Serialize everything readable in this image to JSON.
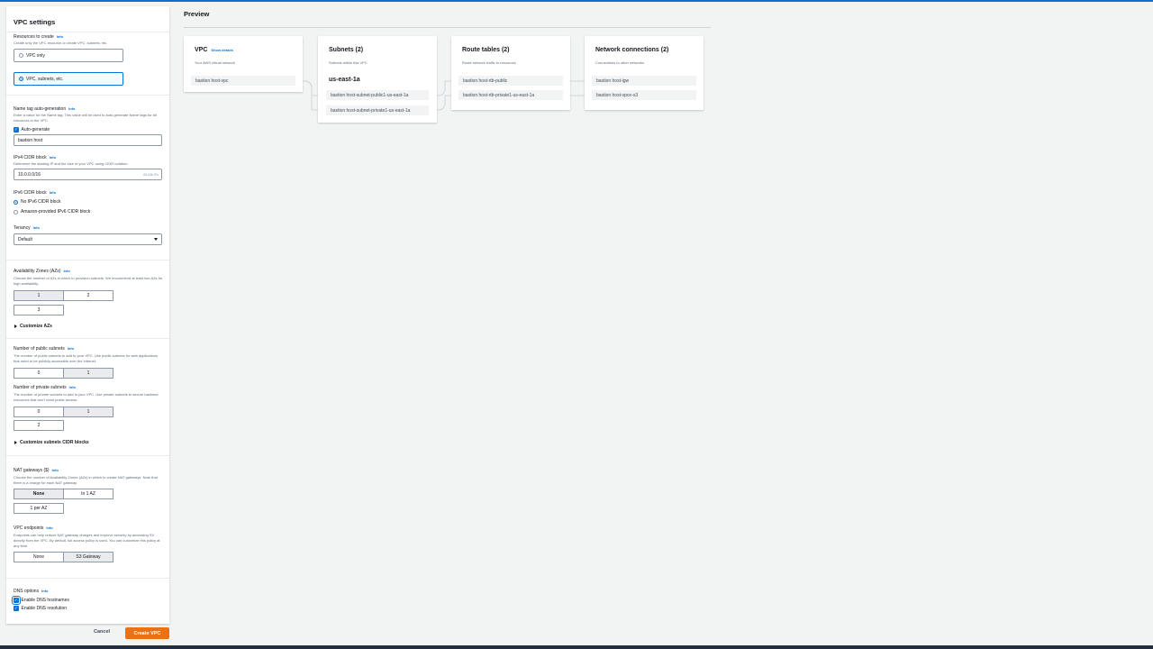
{
  "panel": {
    "title": "VPC settings",
    "info": "Info",
    "resources": {
      "label": "Resources to create",
      "desc": "Create only the VPC resource or create VPC, subnets, etc.",
      "options": [
        "VPC only",
        "VPC, subnets, etc."
      ],
      "selected": "VPC, subnets, etc."
    },
    "name_tag": {
      "label": "Name tag auto-generation",
      "desc": "Enter a value for the Name tag. This value will be used to auto-generate Name tags for all resources in the VPC.",
      "auto_label": "Auto-generate",
      "auto_checked": true,
      "value": "bastion host"
    },
    "ipv4": {
      "label": "IPv4 CIDR block",
      "desc": "Determine the starting IP and the size of your VPC using CIDR notation.",
      "value": "10.0.0.0/16",
      "hint": "65,536 IPs"
    },
    "ipv6": {
      "label": "IPv6 CIDR block",
      "options": [
        "No IPv6 CIDR block",
        "Amazon-provided IPv6 CIDR block"
      ],
      "selected": "No IPv6 CIDR block"
    },
    "tenancy": {
      "label": "Tenancy",
      "value": "Default"
    },
    "azs": {
      "label": "Availability Zones (AZs)",
      "desc": "Choose the number of AZs in which to provision subnets. We recommend at least two AZs for high availability.",
      "options": [
        "1",
        "2",
        "3"
      ],
      "selected": "1",
      "customize": "Customize AZs"
    },
    "public_subnets": {
      "label": "Number of public subnets",
      "desc": "The number of public subnets to add to your VPC. Use public subnets for web applications that need to be publicly accessible over the internet.",
      "options": [
        "0",
        "1"
      ],
      "selected": "1"
    },
    "private_subnets": {
      "label": "Number of private subnets",
      "desc": "The number of private subnets to add to your VPC. Use private subnets to secure backend resources that don't need public access.",
      "options": [
        "0",
        "1",
        "2"
      ],
      "selected": "1",
      "customize": "Customize subnets CIDR blocks"
    },
    "nat": {
      "label": "NAT gateways ($)",
      "desc": "Choose the number of Availability Zones (AZs) in which to create NAT gateways. Note that there is a charge for each NAT gateway",
      "options": [
        "None",
        "In 1 AZ",
        "1 per AZ"
      ],
      "selected": "None"
    },
    "endpoints": {
      "label": "VPC endpoints",
      "desc": "Endpoints can help reduce NAT gateway charges and improve security by accessing S3 directly from the VPC. By default, full access policy is used. You can customize this policy at any time.",
      "options": [
        "None",
        "S3 Gateway"
      ],
      "selected": "S3 Gateway"
    },
    "dns": {
      "label": "DNS options",
      "hostnames": "Enable DNS hostnames",
      "resolution": "Enable DNS resolution"
    },
    "cancel": "Cancel",
    "create": "Create VPC"
  },
  "preview": {
    "title": "Preview",
    "vpc": {
      "title": "VPC",
      "link": "Show details",
      "sub": "Your AWS virtual network",
      "items": [
        "bastion host-vpc"
      ]
    },
    "subnets": {
      "title": "Subnets (2)",
      "sub": "Subnets within this VPC",
      "az": "us-east-1a",
      "items": [
        "bastion host-subnet-public1-us-east-1a",
        "bastion host-subnet-private1-us-east-1a"
      ]
    },
    "route_tables": {
      "title": "Route tables (2)",
      "sub": "Route network traffic to resources",
      "items": [
        "bastion host-rtb-public",
        "bastion host-rtb-private1-us-east-1a"
      ]
    },
    "network": {
      "title": "Network connections (2)",
      "sub": "Connections to other networks",
      "items": [
        "bastion host-igw",
        "bastion host-vpce-s3"
      ]
    }
  },
  "colors": {
    "accent": "#0972d3",
    "primary_button": "#ec7211"
  }
}
